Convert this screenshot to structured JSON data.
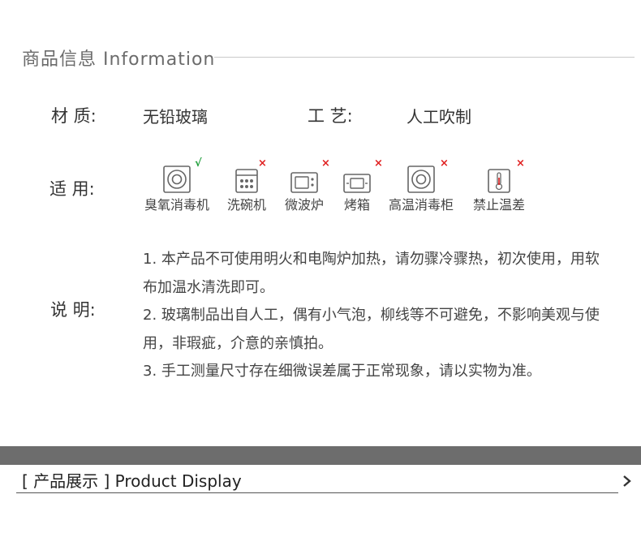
{
  "info": {
    "title": "商品信息  Information"
  },
  "specs": {
    "material_label": "材 质:",
    "material_value": "无铅玻璃",
    "craft_label": "工 艺:",
    "craft_value": "人工吹制"
  },
  "usage": {
    "label": "适 用:",
    "items": [
      {
        "name": "臭氧消毒机",
        "mark": "√",
        "icon": "sterilizer-icon"
      },
      {
        "name": "洗碗机",
        "mark": "×",
        "icon": "dishwasher-icon"
      },
      {
        "name": "微波炉",
        "mark": "×",
        "icon": "microwave-icon"
      },
      {
        "name": "烤箱",
        "mark": "×",
        "icon": "oven-icon"
      },
      {
        "name": "高温消毒柜",
        "mark": "×",
        "icon": "disinfection-cabinet-icon"
      },
      {
        "name": "禁止温差",
        "mark": "×",
        "icon": "thermometer-icon"
      }
    ]
  },
  "notes": {
    "label": "说 明:",
    "lines": [
      "1. 本产品不可使用明火和电陶炉加热，请勿骤冷骤热，初次使用，用软布加温水清洗即可。",
      "2. 玻璃制品出自人工，偶有小气泡，柳线等不可避免，不影响美观与使用，非瑕疵，介意的亲慎拍。",
      "3. 手工测量尺寸存在细微误差属于正常现象，请以实物为准。"
    ]
  },
  "product_display": {
    "title": "[ 产品展示 ] Product Display"
  },
  "colors": {
    "ok_mark": "#1e9e3a",
    "no_mark": "#e02020",
    "band": "#6d6d6d"
  }
}
